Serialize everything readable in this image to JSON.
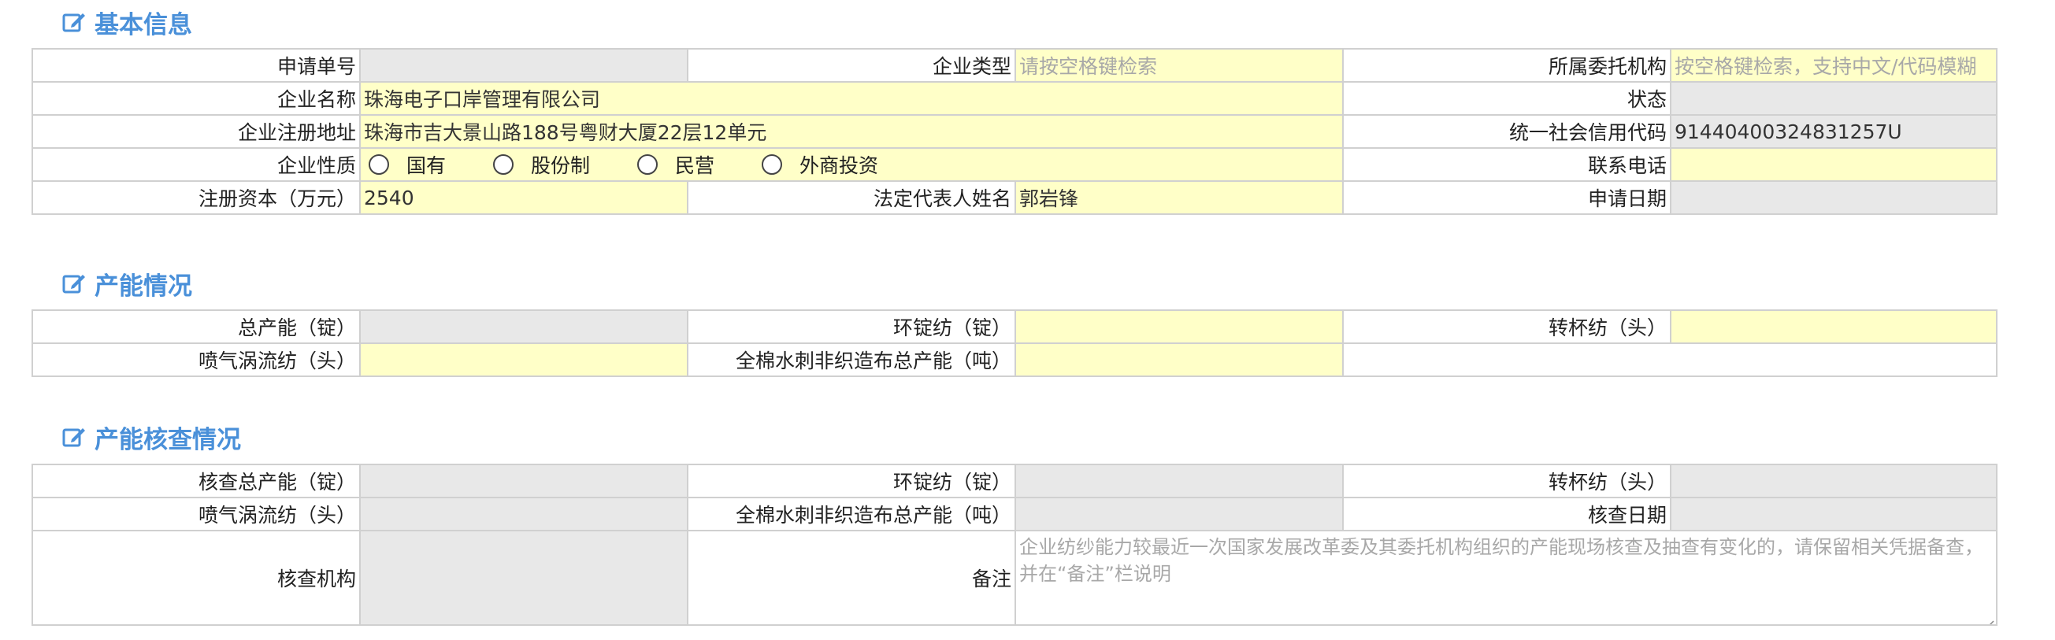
{
  "sections": {
    "basic": {
      "title": "基本信息"
    },
    "capacity": {
      "title": "产能情况"
    },
    "inspection": {
      "title": "产能核查情况"
    }
  },
  "basic": {
    "application_no": {
      "label": "申请单号",
      "value": ""
    },
    "enterprise_type": {
      "label": "企业类型",
      "placeholder": "请按空格键检索"
    },
    "agency": {
      "label": "所属委托机构",
      "placeholder": "按空格键检索，支持中文/代码模糊"
    },
    "enterprise_name": {
      "label": "企业名称",
      "value": "珠海电子口岸管理有限公司"
    },
    "status": {
      "label": "状态",
      "value": ""
    },
    "address": {
      "label": "企业注册地址",
      "value": "珠海市吉大景山路188号粤财大厦22层12单元"
    },
    "credit_code": {
      "label": "统一社会信用代码",
      "value": "91440400324831257U"
    },
    "nature": {
      "label": "企业性质",
      "options": [
        "国有",
        "股份制",
        "民营",
        "外商投资"
      ]
    },
    "phone": {
      "label": "联系电话",
      "value": ""
    },
    "capital": {
      "label": "注册资本（万元）",
      "value": "2540"
    },
    "legal_rep": {
      "label": "法定代表人姓名",
      "value": "郭岩锋"
    },
    "apply_date": {
      "label": "申请日期",
      "value": ""
    }
  },
  "capacity": {
    "total": {
      "label": "总产能（锭）",
      "value": ""
    },
    "ring": {
      "label": "环锭纺（锭）",
      "value": ""
    },
    "rotor": {
      "label": "转杯纺（头）",
      "value": ""
    },
    "vortex": {
      "label": "喷气涡流纺（头）",
      "value": ""
    },
    "cotton_spunlace": {
      "label": "全棉水刺非织造布总产能（吨）",
      "value": ""
    }
  },
  "inspection": {
    "total": {
      "label": "核查总产能（锭）",
      "value": ""
    },
    "ring": {
      "label": "环锭纺（锭）",
      "value": ""
    },
    "rotor": {
      "label": "转杯纺（头）",
      "value": ""
    },
    "vortex": {
      "label": "喷气涡流纺（头）",
      "value": ""
    },
    "cotton_spunlace": {
      "label": "全棉水刺非织造布总产能（吨）",
      "value": ""
    },
    "date": {
      "label": "核查日期",
      "value": ""
    },
    "agency": {
      "label": "核查机构",
      "value": ""
    },
    "remark": {
      "label": "备注",
      "placeholder": "企业纺纱能力较最近一次国家发展改革委及其委托机构组织的产能现场核查及抽查有变化的，请保留相关凭据备查，并在“备注”栏说明"
    }
  },
  "colors": {
    "accent": "#4a90d9",
    "required_bg": "#ffffc8",
    "readonly_bg": "#e8e8e8",
    "border": "#d0d0d0",
    "placeholder": "#a8a8a8"
  },
  "icons": {
    "section": "edit-icon"
  }
}
